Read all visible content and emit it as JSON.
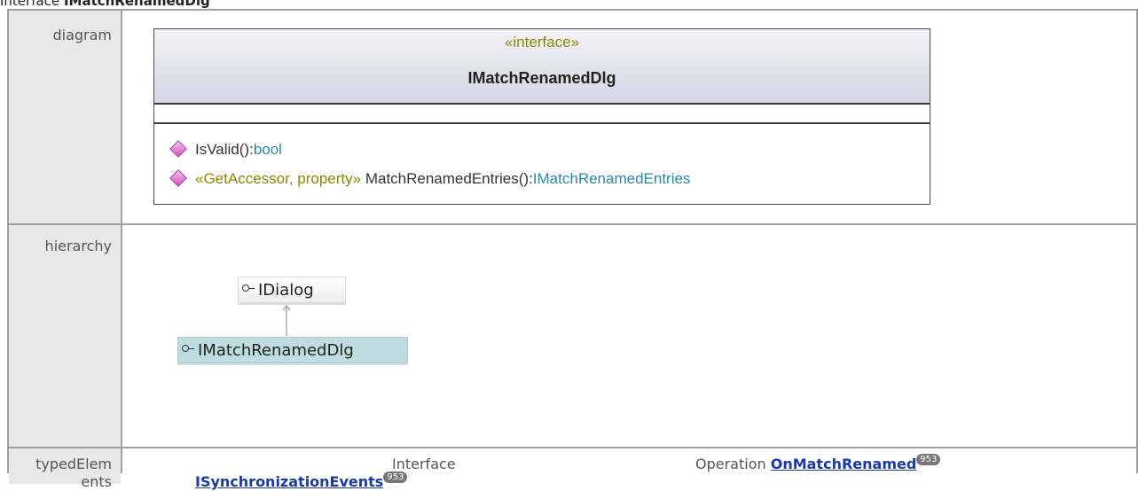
{
  "page": {
    "title_prefix": "Interface",
    "title_name": "IMatchRenamedDlg"
  },
  "rows": {
    "diagram_label": "diagram",
    "hierarchy_label": "hierarchy",
    "typed_label_1": "typedElem",
    "typed_label_2": "ents"
  },
  "uml": {
    "stereotype": "«interface»",
    "name": "IMatchRenamedDlg",
    "operations": [
      {
        "stereotype": "",
        "name": "IsValid():",
        "type": "bool"
      },
      {
        "stereotype": "«GetAccessor, property»",
        "name": "MatchRenamedEntries():",
        "type": "IMatchRenamedEntries"
      }
    ]
  },
  "hierarchy": {
    "parent": "IDialog",
    "child": "IMatchRenamedDlg"
  },
  "typed_elements": {
    "kind_1": "Interface",
    "link_1": "ISynchronizationEvents",
    "badge_1": "953",
    "kind_2": "Operation",
    "link_2": "OnMatchRenamed",
    "badge_2": "953"
  },
  "colors": {
    "label_bg": "#e8e8e8",
    "grid": "#a0a0a0",
    "link": "#1a3aa8",
    "type": "#2a8aa8",
    "stereotype": "#8a8a00"
  }
}
